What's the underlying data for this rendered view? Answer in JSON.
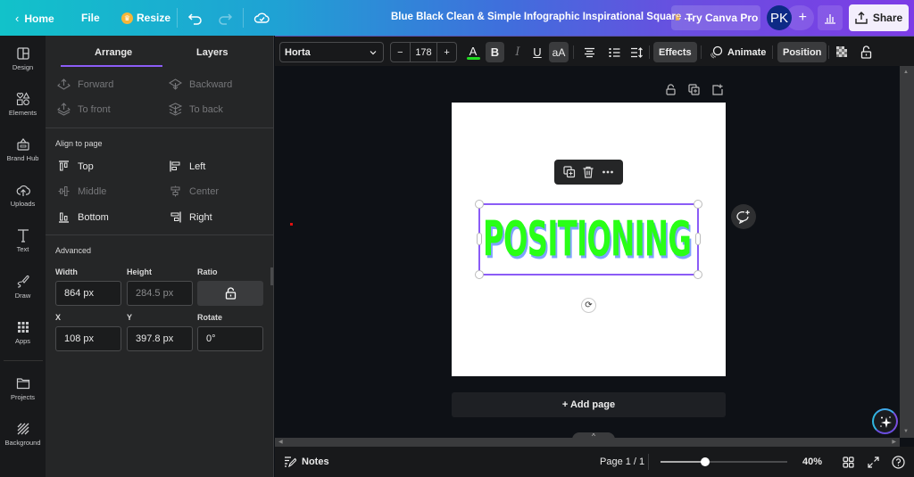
{
  "topbar": {
    "home_label": "Home",
    "file_label": "File",
    "resize_label": "Resize",
    "title": "Blue Black Clean & Simple Infographic Inspirational Square ...",
    "try_pro_label": "Try Canva Pro",
    "avatar_initials": "PK",
    "share_label": "Share"
  },
  "sidebar": {
    "items": [
      {
        "label": "Design",
        "icon": "layout-icon"
      },
      {
        "label": "Elements",
        "icon": "shapes-icon"
      },
      {
        "label": "Brand Hub",
        "icon": "brand-icon"
      },
      {
        "label": "Uploads",
        "icon": "cloud-upload-icon"
      },
      {
        "label": "Text",
        "icon": "text-icon"
      },
      {
        "label": "Draw",
        "icon": "pen-icon"
      },
      {
        "label": "Apps",
        "icon": "grid-icon"
      },
      {
        "label": "Projects",
        "icon": "folder-icon"
      },
      {
        "label": "Background",
        "icon": "hatch-icon"
      }
    ]
  },
  "panel": {
    "tabs": [
      {
        "label": "Arrange",
        "active": true
      },
      {
        "label": "Layers",
        "active": false
      }
    ],
    "arrange": {
      "forward": "Forward",
      "backward": "Backward",
      "to_front": "To front",
      "to_back": "To back"
    },
    "align_section_label": "Align to page",
    "align": {
      "top": "Top",
      "left": "Left",
      "middle": "Middle",
      "center": "Center",
      "bottom": "Bottom",
      "right": "Right"
    },
    "advanced_label": "Advanced",
    "fields": {
      "width_label": "Width",
      "width_value": "864 px",
      "height_label": "Height",
      "height_value": "284.5 px",
      "ratio_label": "Ratio",
      "x_label": "X",
      "x_value": "108 px",
      "y_label": "Y",
      "y_value": "397.8 px",
      "rotate_label": "Rotate",
      "rotate_value": "0°"
    }
  },
  "toolbar": {
    "font_family": "Horta",
    "font_size": "178",
    "minus": "−",
    "plus": "+",
    "text_color": "#22dd22",
    "bold": "B",
    "italic": "I",
    "underline": "U",
    "case": "aA",
    "effects_label": "Effects",
    "animate_label": "Animate",
    "position_label": "Position"
  },
  "canvas": {
    "text": "POSITIONING",
    "text_color": "#29ff16",
    "shadow_color": "#7fa3ff",
    "add_page_label": "+ Add page"
  },
  "footer": {
    "notes_label": "Notes",
    "page_indicator": "Page 1 / 1",
    "zoom_percent": 40,
    "zoom_label": "40%",
    "zoom_slider_fraction": 0.35
  }
}
